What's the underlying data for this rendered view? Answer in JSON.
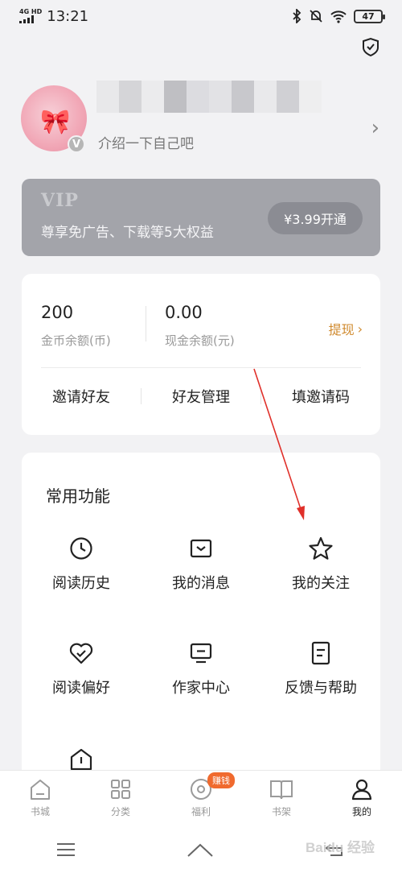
{
  "status_bar": {
    "network": "4G HD",
    "time": "13:21",
    "battery": "47"
  },
  "profile": {
    "bio": "介绍一下自己吧",
    "badge": "V"
  },
  "vip": {
    "title": "VIP",
    "desc": "尊享免广告、下载等5大权益",
    "button": "¥3.99开通"
  },
  "wallet": {
    "coins_value": "200",
    "coins_label": "金币余额(币)",
    "cash_value": "0.00",
    "cash_label": "现金余额(元)",
    "withdraw": "提现",
    "links": [
      "邀请好友",
      "好友管理",
      "填邀请码"
    ]
  },
  "functions": {
    "title": "常用功能",
    "items": [
      {
        "label": "阅读历史",
        "icon": "clock-icon"
      },
      {
        "label": "我的消息",
        "icon": "inbox-icon"
      },
      {
        "label": "我的关注",
        "icon": "star-icon"
      },
      {
        "label": "阅读偏好",
        "icon": "heart-check-icon"
      },
      {
        "label": "作家中心",
        "icon": "monitor-icon"
      },
      {
        "label": "反馈与帮助",
        "icon": "document-icon"
      },
      {
        "label": "",
        "icon": "pentagon-icon"
      }
    ]
  },
  "tabbar": {
    "tabs": [
      {
        "label": "书城",
        "icon": "home-icon"
      },
      {
        "label": "分类",
        "icon": "grid-icon"
      },
      {
        "label": "福利",
        "icon": "coin-icon",
        "badge": "赚钱"
      },
      {
        "label": "书架",
        "icon": "book-icon"
      },
      {
        "label": "我的",
        "icon": "user-icon",
        "active": true
      }
    ]
  },
  "watermark": "Baidu 经验",
  "colors": {
    "accent": "#d08a2e",
    "vip_bg": "#a3a4aa",
    "badge": "#f06a2e",
    "arrow": "#e0302a"
  }
}
